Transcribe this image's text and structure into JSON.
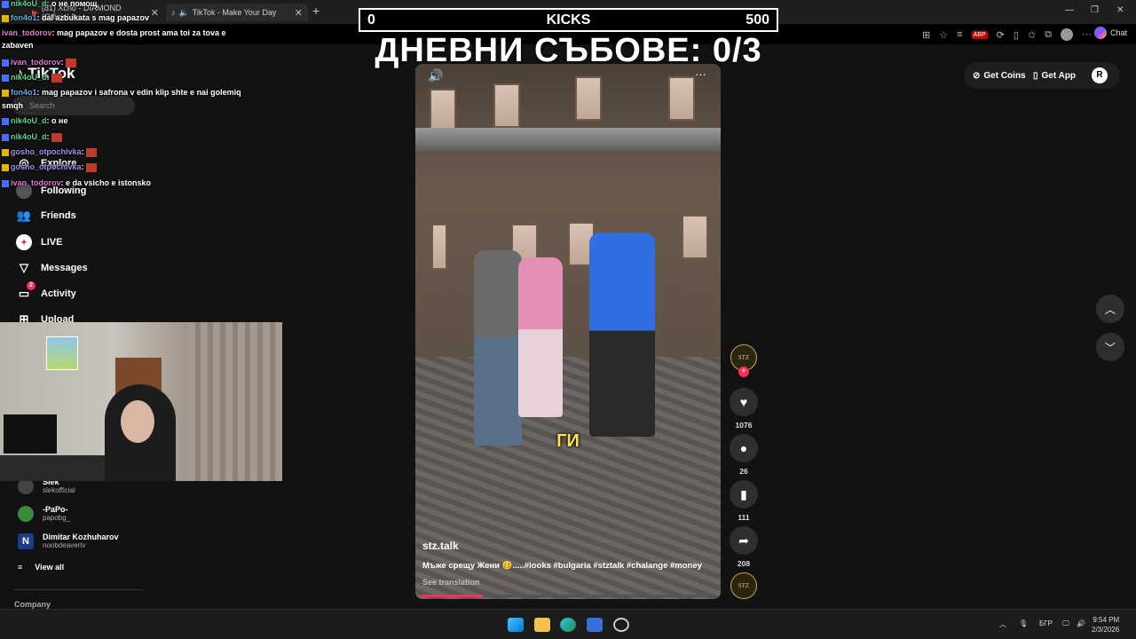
{
  "browser": {
    "tabs": [
      {
        "label": "(81) Xcho - DIAMOND (Official Au",
        "icon": "youtube-icon"
      },
      {
        "label": "TikTok - Make Your Day",
        "icon": "tiktok-icon"
      }
    ],
    "chat_label": "Chat"
  },
  "overlay": {
    "score_left": "0",
    "score_title": "KICKS",
    "score_right": "500",
    "daily_title": "ДНЕВНИ СЪБОВЕ: 0/3"
  },
  "chat": [
    {
      "user": "nik4oU_d",
      "text": ": о не помощ",
      "color": "u-green"
    },
    {
      "user": "fon4o1",
      "text": ": dal azbukata s mag papazov",
      "color": "u-blue"
    },
    {
      "user": "ivan_todorov",
      "text": ": mag papazov e dosta prost ama toi za tova e",
      "color": "u-pink"
    },
    {
      "user": "",
      "text": "zabaven",
      "color": ""
    },
    {
      "user": "ivan_todorov",
      "text": ":",
      "color": "u-pink"
    },
    {
      "user": "nik4oU_d",
      "text": ":",
      "color": "u-green"
    },
    {
      "user": "fon4o1",
      "text": ": mag papazov i safrona v edin klip shte e nai golemiq",
      "color": "u-blue"
    },
    {
      "user": "",
      "text": "smqh",
      "color": ""
    },
    {
      "user": "nik4oU_d",
      "text": ": о не",
      "color": "u-green"
    },
    {
      "user": "nik4oU_d",
      "text": ":",
      "color": "u-green"
    },
    {
      "user": "gosho_otpochivka",
      "text": ":",
      "color": "u-purple"
    },
    {
      "user": "gosho_otpochivka",
      "text": ":",
      "color": "u-purple"
    },
    {
      "user": "ivan_todorov",
      "text": ": e da vsicho e istonsko",
      "color": "u-pink"
    }
  ],
  "tiktok": {
    "logo": "TikTok",
    "search_placeholder": "Search",
    "nav": [
      {
        "label": "Explore",
        "icon": "compass-icon"
      },
      {
        "label": "Following",
        "icon": "following-icon"
      },
      {
        "label": "Friends",
        "icon": "friends-icon"
      },
      {
        "label": "LIVE",
        "icon": "live-icon"
      },
      {
        "label": "Messages",
        "icon": "messages-icon"
      },
      {
        "label": "Activity",
        "icon": "activity-icon",
        "badge": "2"
      },
      {
        "label": "Upload",
        "icon": "upload-icon"
      }
    ],
    "following_accounts": [
      {
        "name": "Slek",
        "handle": "slekofficial"
      },
      {
        "name": "-PaPo-",
        "handle": "papobg_"
      },
      {
        "name": "Dimitar Kozhuharov",
        "handle": "noobdeavertv"
      }
    ],
    "view_all": "View all",
    "company": "Company",
    "get_coins": "Get Coins",
    "get_app": "Get App",
    "profile_initial": "R"
  },
  "video": {
    "caption_overlay": "ГИ",
    "author": "stz.talk",
    "description": "Мъже срещу Жени 🥴.....#looks #bulgaria #stztalk #chalange #money",
    "see_translation": "See translation",
    "avatar_text": "STZ",
    "likes": "1076",
    "comments": "26",
    "saves": "111",
    "shares": "208",
    "progress": 0.21
  },
  "taskbar": {
    "lang": "БГР",
    "time": "9:54 PM",
    "date": "2/3/2026"
  }
}
